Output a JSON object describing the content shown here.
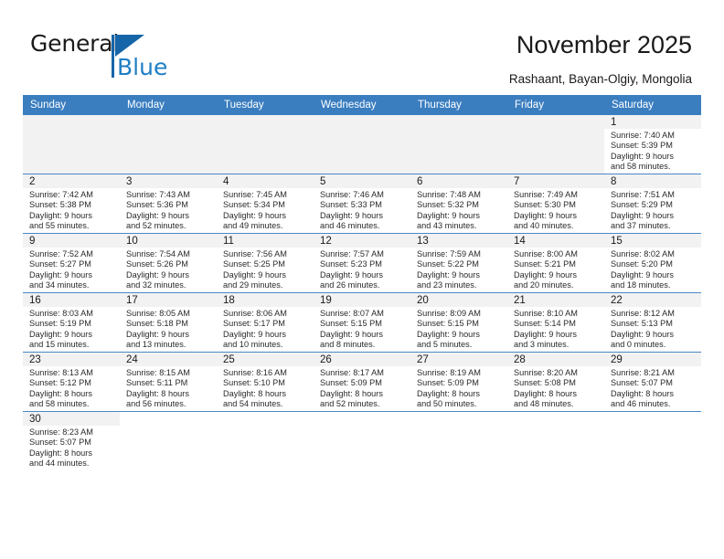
{
  "brand": {
    "name_top": "General",
    "name_bottom": "Blue",
    "accent_color": "#1f7fc4",
    "triangle_color": "#1565a8"
  },
  "header": {
    "title": "November 2025",
    "subtitle": "Rashaant, Bayan-Olgiy, Mongolia",
    "header_row_color": "#3a7ec0"
  },
  "weekdays": [
    "Sunday",
    "Monday",
    "Tuesday",
    "Wednesday",
    "Thursday",
    "Friday",
    "Saturday"
  ],
  "weeks": [
    [
      {
        "day": "",
        "sunrise": "",
        "sunset": "",
        "daylight1": "",
        "daylight2": "",
        "blank": true
      },
      {
        "day": "",
        "sunrise": "",
        "sunset": "",
        "daylight1": "",
        "daylight2": "",
        "blank": true
      },
      {
        "day": "",
        "sunrise": "",
        "sunset": "",
        "daylight1": "",
        "daylight2": "",
        "blank": true
      },
      {
        "day": "",
        "sunrise": "",
        "sunset": "",
        "daylight1": "",
        "daylight2": "",
        "blank": true
      },
      {
        "day": "",
        "sunrise": "",
        "sunset": "",
        "daylight1": "",
        "daylight2": "",
        "blank": true
      },
      {
        "day": "",
        "sunrise": "",
        "sunset": "",
        "daylight1": "",
        "daylight2": "",
        "blank": true
      },
      {
        "day": "1",
        "sunrise": "Sunrise: 7:40 AM",
        "sunset": "Sunset: 5:39 PM",
        "daylight1": "Daylight: 9 hours",
        "daylight2": "and 58 minutes.",
        "blank": false
      }
    ],
    [
      {
        "day": "2",
        "sunrise": "Sunrise: 7:42 AM",
        "sunset": "Sunset: 5:38 PM",
        "daylight1": "Daylight: 9 hours",
        "daylight2": "and 55 minutes.",
        "blank": false
      },
      {
        "day": "3",
        "sunrise": "Sunrise: 7:43 AM",
        "sunset": "Sunset: 5:36 PM",
        "daylight1": "Daylight: 9 hours",
        "daylight2": "and 52 minutes.",
        "blank": false
      },
      {
        "day": "4",
        "sunrise": "Sunrise: 7:45 AM",
        "sunset": "Sunset: 5:34 PM",
        "daylight1": "Daylight: 9 hours",
        "daylight2": "and 49 minutes.",
        "blank": false
      },
      {
        "day": "5",
        "sunrise": "Sunrise: 7:46 AM",
        "sunset": "Sunset: 5:33 PM",
        "daylight1": "Daylight: 9 hours",
        "daylight2": "and 46 minutes.",
        "blank": false
      },
      {
        "day": "6",
        "sunrise": "Sunrise: 7:48 AM",
        "sunset": "Sunset: 5:32 PM",
        "daylight1": "Daylight: 9 hours",
        "daylight2": "and 43 minutes.",
        "blank": false
      },
      {
        "day": "7",
        "sunrise": "Sunrise: 7:49 AM",
        "sunset": "Sunset: 5:30 PM",
        "daylight1": "Daylight: 9 hours",
        "daylight2": "and 40 minutes.",
        "blank": false
      },
      {
        "day": "8",
        "sunrise": "Sunrise: 7:51 AM",
        "sunset": "Sunset: 5:29 PM",
        "daylight1": "Daylight: 9 hours",
        "daylight2": "and 37 minutes.",
        "blank": false
      }
    ],
    [
      {
        "day": "9",
        "sunrise": "Sunrise: 7:52 AM",
        "sunset": "Sunset: 5:27 PM",
        "daylight1": "Daylight: 9 hours",
        "daylight2": "and 34 minutes.",
        "blank": false
      },
      {
        "day": "10",
        "sunrise": "Sunrise: 7:54 AM",
        "sunset": "Sunset: 5:26 PM",
        "daylight1": "Daylight: 9 hours",
        "daylight2": "and 32 minutes.",
        "blank": false
      },
      {
        "day": "11",
        "sunrise": "Sunrise: 7:56 AM",
        "sunset": "Sunset: 5:25 PM",
        "daylight1": "Daylight: 9 hours",
        "daylight2": "and 29 minutes.",
        "blank": false
      },
      {
        "day": "12",
        "sunrise": "Sunrise: 7:57 AM",
        "sunset": "Sunset: 5:23 PM",
        "daylight1": "Daylight: 9 hours",
        "daylight2": "and 26 minutes.",
        "blank": false
      },
      {
        "day": "13",
        "sunrise": "Sunrise: 7:59 AM",
        "sunset": "Sunset: 5:22 PM",
        "daylight1": "Daylight: 9 hours",
        "daylight2": "and 23 minutes.",
        "blank": false
      },
      {
        "day": "14",
        "sunrise": "Sunrise: 8:00 AM",
        "sunset": "Sunset: 5:21 PM",
        "daylight1": "Daylight: 9 hours",
        "daylight2": "and 20 minutes.",
        "blank": false
      },
      {
        "day": "15",
        "sunrise": "Sunrise: 8:02 AM",
        "sunset": "Sunset: 5:20 PM",
        "daylight1": "Daylight: 9 hours",
        "daylight2": "and 18 minutes.",
        "blank": false
      }
    ],
    [
      {
        "day": "16",
        "sunrise": "Sunrise: 8:03 AM",
        "sunset": "Sunset: 5:19 PM",
        "daylight1": "Daylight: 9 hours",
        "daylight2": "and 15 minutes.",
        "blank": false
      },
      {
        "day": "17",
        "sunrise": "Sunrise: 8:05 AM",
        "sunset": "Sunset: 5:18 PM",
        "daylight1": "Daylight: 9 hours",
        "daylight2": "and 13 minutes.",
        "blank": false
      },
      {
        "day": "18",
        "sunrise": "Sunrise: 8:06 AM",
        "sunset": "Sunset: 5:17 PM",
        "daylight1": "Daylight: 9 hours",
        "daylight2": "and 10 minutes.",
        "blank": false
      },
      {
        "day": "19",
        "sunrise": "Sunrise: 8:07 AM",
        "sunset": "Sunset: 5:15 PM",
        "daylight1": "Daylight: 9 hours",
        "daylight2": "and 8 minutes.",
        "blank": false
      },
      {
        "day": "20",
        "sunrise": "Sunrise: 8:09 AM",
        "sunset": "Sunset: 5:15 PM",
        "daylight1": "Daylight: 9 hours",
        "daylight2": "and 5 minutes.",
        "blank": false
      },
      {
        "day": "21",
        "sunrise": "Sunrise: 8:10 AM",
        "sunset": "Sunset: 5:14 PM",
        "daylight1": "Daylight: 9 hours",
        "daylight2": "and 3 minutes.",
        "blank": false
      },
      {
        "day": "22",
        "sunrise": "Sunrise: 8:12 AM",
        "sunset": "Sunset: 5:13 PM",
        "daylight1": "Daylight: 9 hours",
        "daylight2": "and 0 minutes.",
        "blank": false
      }
    ],
    [
      {
        "day": "23",
        "sunrise": "Sunrise: 8:13 AM",
        "sunset": "Sunset: 5:12 PM",
        "daylight1": "Daylight: 8 hours",
        "daylight2": "and 58 minutes.",
        "blank": false
      },
      {
        "day": "24",
        "sunrise": "Sunrise: 8:15 AM",
        "sunset": "Sunset: 5:11 PM",
        "daylight1": "Daylight: 8 hours",
        "daylight2": "and 56 minutes.",
        "blank": false
      },
      {
        "day": "25",
        "sunrise": "Sunrise: 8:16 AM",
        "sunset": "Sunset: 5:10 PM",
        "daylight1": "Daylight: 8 hours",
        "daylight2": "and 54 minutes.",
        "blank": false
      },
      {
        "day": "26",
        "sunrise": "Sunrise: 8:17 AM",
        "sunset": "Sunset: 5:09 PM",
        "daylight1": "Daylight: 8 hours",
        "daylight2": "and 52 minutes.",
        "blank": false
      },
      {
        "day": "27",
        "sunrise": "Sunrise: 8:19 AM",
        "sunset": "Sunset: 5:09 PM",
        "daylight1": "Daylight: 8 hours",
        "daylight2": "and 50 minutes.",
        "blank": false
      },
      {
        "day": "28",
        "sunrise": "Sunrise: 8:20 AM",
        "sunset": "Sunset: 5:08 PM",
        "daylight1": "Daylight: 8 hours",
        "daylight2": "and 48 minutes.",
        "blank": false
      },
      {
        "day": "29",
        "sunrise": "Sunrise: 8:21 AM",
        "sunset": "Sunset: 5:07 PM",
        "daylight1": "Daylight: 8 hours",
        "daylight2": "and 46 minutes.",
        "blank": false
      }
    ],
    [
      {
        "day": "30",
        "sunrise": "Sunrise: 8:23 AM",
        "sunset": "Sunset: 5:07 PM",
        "daylight1": "Daylight: 8 hours",
        "daylight2": "and 44 minutes.",
        "blank": false
      },
      {
        "day": "",
        "sunrise": "",
        "sunset": "",
        "daylight1": "",
        "daylight2": "",
        "blank": true,
        "empty_white": true
      },
      {
        "day": "",
        "sunrise": "",
        "sunset": "",
        "daylight1": "",
        "daylight2": "",
        "blank": true,
        "empty_white": true
      },
      {
        "day": "",
        "sunrise": "",
        "sunset": "",
        "daylight1": "",
        "daylight2": "",
        "blank": true,
        "empty_white": true
      },
      {
        "day": "",
        "sunrise": "",
        "sunset": "",
        "daylight1": "",
        "daylight2": "",
        "blank": true,
        "empty_white": true
      },
      {
        "day": "",
        "sunrise": "",
        "sunset": "",
        "daylight1": "",
        "daylight2": "",
        "blank": true,
        "empty_white": true
      },
      {
        "day": "",
        "sunrise": "",
        "sunset": "",
        "daylight1": "",
        "daylight2": "",
        "blank": true,
        "empty_white": true
      }
    ]
  ]
}
